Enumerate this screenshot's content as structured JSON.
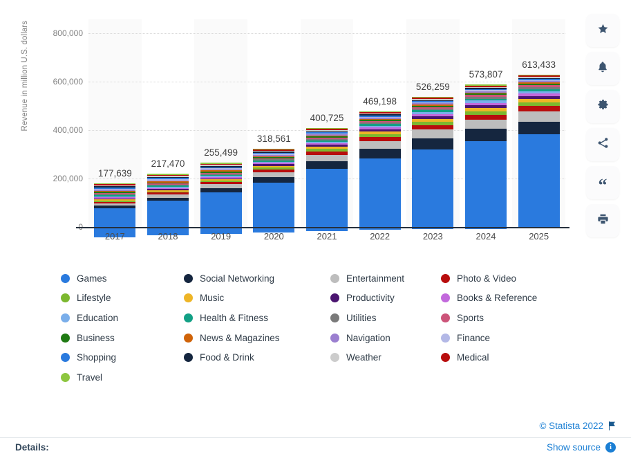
{
  "chart_data": {
    "type": "bar",
    "stacked": true,
    "title": "",
    "xlabel": "",
    "ylabel": "Revenue in million U.S. dollars",
    "categories": [
      "2017",
      "2018",
      "2019",
      "2020",
      "2021",
      "2022",
      "2023",
      "2024",
      "2025"
    ],
    "ylim": [
      0,
      800000
    ],
    "yticks": [
      0,
      200000,
      400000,
      600000,
      800000
    ],
    "ytick_labels": [
      "0",
      "200,000",
      "400,000",
      "600,000",
      "800,000"
    ],
    "grid": true,
    "legend_position": "bottom",
    "totals": [
      177639,
      217470,
      255499,
      318561,
      400725,
      469198,
      526259,
      573807,
      613433
    ],
    "total_labels": [
      "177,639",
      "217,470",
      "255,499",
      "318,561",
      "400,725",
      "469,198",
      "526,259",
      "573,807",
      "613,433"
    ],
    "series": [
      {
        "name": "Games",
        "color": "#2a7ade",
        "values": [
          120500,
          144300,
          172800,
          205300,
          255000,
          294500,
          330500,
          362000,
          388000
        ]
      },
      {
        "name": "Social Networking",
        "color": "#15263f",
        "values": [
          9500,
          12500,
          16500,
          23500,
          32500,
          40000,
          46000,
          50500,
          54000
        ]
      },
      {
        "name": "Entertainment",
        "color": "#bdbdbd",
        "values": [
          11000,
          13500,
          16000,
          20500,
          26500,
          31500,
          35500,
          38500,
          41000
        ]
      },
      {
        "name": "Photo & Video",
        "color": "#b80d0d",
        "values": [
          5500,
          7000,
          8500,
          11000,
          14500,
          17000,
          19000,
          20500,
          22000
        ]
      },
      {
        "name": "Lifestyle",
        "color": "#7cb82f",
        "values": [
          4200,
          5200,
          6200,
          7800,
          10000,
          11800,
          13200,
          14300,
          15300
        ]
      },
      {
        "name": "Music",
        "color": "#eeb526",
        "values": [
          4000,
          4900,
          5800,
          7300,
          9200,
          10800,
          12100,
          13200,
          14100
        ]
      },
      {
        "name": "Productivity",
        "color": "#4b1570",
        "values": [
          3400,
          4200,
          4900,
          6200,
          7800,
          9200,
          10300,
          11200,
          12000
        ]
      },
      {
        "name": "Books & Reference",
        "color": "#c269dc",
        "values": [
          3000,
          3700,
          4400,
          5500,
          6900,
          8100,
          9100,
          9900,
          10600
        ]
      },
      {
        "name": "Education",
        "color": "#7aaeea",
        "values": [
          2800,
          3400,
          4100,
          5100,
          6400,
          7600,
          8500,
          9300,
          9900
        ]
      },
      {
        "name": "Health & Fitness",
        "color": "#12a085",
        "values": [
          2500,
          3100,
          3700,
          4600,
          5800,
          6800,
          7700,
          8400,
          9000
        ]
      },
      {
        "name": "Utilities",
        "color": "#7a7a7a",
        "values": [
          2300,
          2800,
          3400,
          4200,
          5300,
          6300,
          7000,
          7700,
          8200
        ]
      },
      {
        "name": "Sports",
        "color": "#cc5479",
        "values": [
          2000,
          2500,
          3000,
          3700,
          4700,
          5500,
          6200,
          6800,
          7200
        ]
      },
      {
        "name": "Business",
        "color": "#1f7a13",
        "values": [
          1800,
          2200,
          2700,
          3300,
          4200,
          4900,
          5500,
          6000,
          6400
        ]
      },
      {
        "name": "News & Magazines",
        "color": "#d06308",
        "values": [
          1600,
          2000,
          2400,
          3000,
          3800,
          4400,
          5000,
          5400,
          5800
        ]
      },
      {
        "name": "Navigation",
        "color": "#9b7fd0",
        "values": [
          1400,
          1700,
          2100,
          2600,
          3300,
          3800,
          4300,
          4700,
          5000
        ]
      },
      {
        "name": "Finance",
        "color": "#b3b8e6",
        "values": [
          1300,
          1600,
          1900,
          2400,
          3000,
          3500,
          3900,
          4300,
          4600
        ]
      },
      {
        "name": "Shopping",
        "color": "#2a7ade",
        "values": [
          1100,
          1400,
          1700,
          2100,
          2600,
          3000,
          3400,
          3700,
          4000
        ]
      },
      {
        "name": "Food & Drink",
        "color": "#15263f",
        "values": [
          1000,
          1200,
          1500,
          1800,
          2300,
          2700,
          3000,
          3300,
          3500
        ]
      },
      {
        "name": "Weather",
        "color": "#cccccc",
        "values": [
          900,
          1100,
          1300,
          1600,
          2000,
          2400,
          2700,
          2900,
          3100
        ]
      },
      {
        "name": "Medical",
        "color": "#b80d0d",
        "values": [
          800,
          1000,
          1200,
          1500,
          1900,
          2200,
          2500,
          2700,
          2900
        ]
      },
      {
        "name": "Travel",
        "color": "#8dc63f",
        "values": [
          700,
          900,
          1100,
          1300,
          1700,
          2000,
          2200,
          2400,
          2600
        ]
      }
    ]
  },
  "legend": {
    "columns": [
      [
        {
          "label": "Games",
          "color": "#2a7ade"
        },
        {
          "label": "Lifestyle",
          "color": "#7cb82f"
        },
        {
          "label": "Education",
          "color": "#7aaeea"
        },
        {
          "label": "Business",
          "color": "#1f7a13"
        },
        {
          "label": "Shopping",
          "color": "#2a7ade"
        },
        {
          "label": "Travel",
          "color": "#8dc63f"
        }
      ],
      [
        {
          "label": "Social Networking",
          "color": "#15263f"
        },
        {
          "label": "Music",
          "color": "#eeb526"
        },
        {
          "label": "Health & Fitness",
          "color": "#12a085"
        },
        {
          "label": "News & Magazines",
          "color": "#d06308"
        },
        {
          "label": "Food & Drink",
          "color": "#15263f"
        }
      ],
      [
        {
          "label": "Entertainment",
          "color": "#bdbdbd"
        },
        {
          "label": "Productivity",
          "color": "#4b1570"
        },
        {
          "label": "Utilities",
          "color": "#7a7a7a"
        },
        {
          "label": "Navigation",
          "color": "#9b7fd0"
        },
        {
          "label": "Weather",
          "color": "#cccccc"
        }
      ],
      [
        {
          "label": "Photo & Video",
          "color": "#b80d0d"
        },
        {
          "label": "Books & Reference",
          "color": "#c269dc"
        },
        {
          "label": "Sports",
          "color": "#cc5479"
        },
        {
          "label": "Finance",
          "color": "#b3b8e6"
        },
        {
          "label": "Medical",
          "color": "#b80d0d"
        }
      ]
    ]
  },
  "toolbar": {
    "buttons": [
      {
        "icon": "star-icon",
        "title": "Favorite"
      },
      {
        "icon": "bell-icon",
        "title": "Notify"
      },
      {
        "icon": "gear-icon",
        "title": "Settings"
      },
      {
        "icon": "share-icon",
        "title": "Share"
      },
      {
        "icon": "quote-icon",
        "title": "Cite"
      },
      {
        "icon": "print-icon",
        "title": "Print"
      }
    ]
  },
  "footer": {
    "copyright": "© Statista 2022",
    "details_label": "Details:",
    "show_source": "Show source",
    "info_glyph": "i"
  },
  "colors": {
    "accent_blue": "#1b7fd4",
    "axis_text": "#808080",
    "band": "#fafafa"
  }
}
